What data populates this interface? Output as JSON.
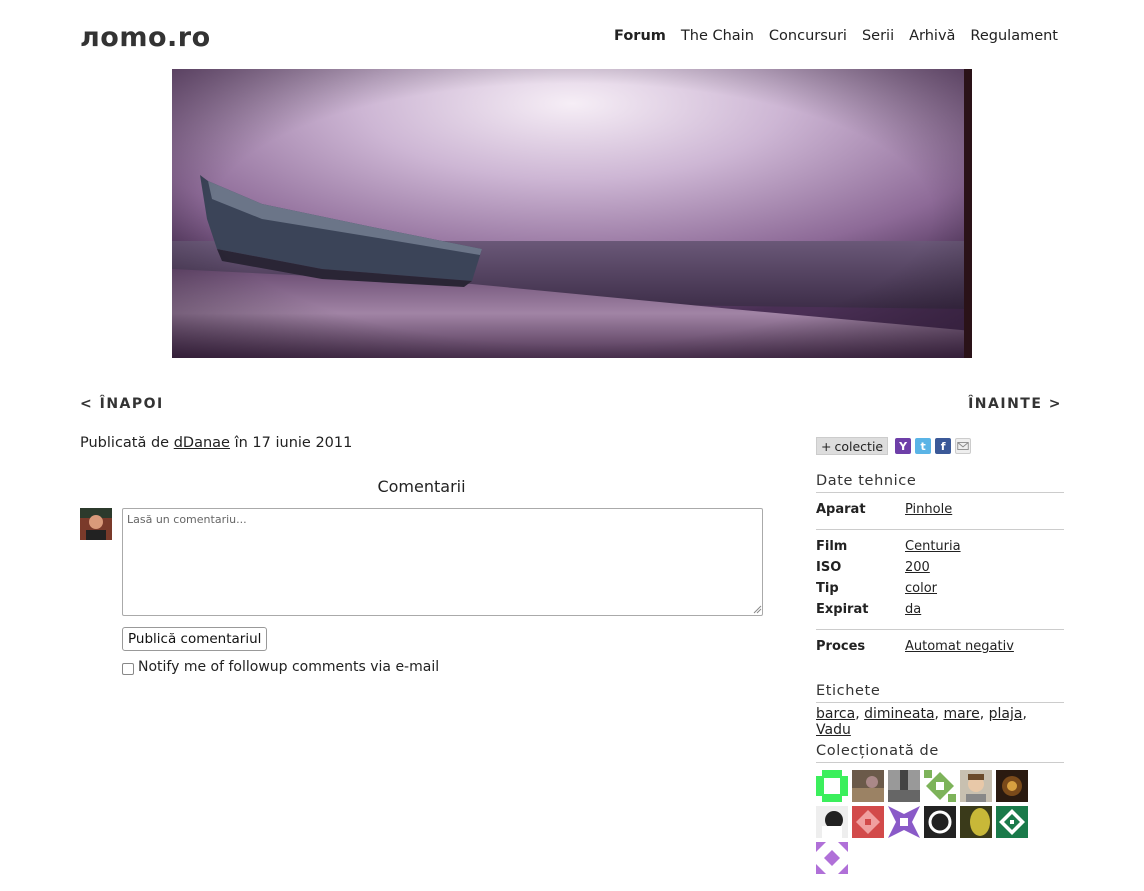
{
  "header": {
    "logo": "лomo.ro",
    "nav": [
      "Forum",
      "The Chain",
      "Concursuri",
      "Serii",
      "Arhivă",
      "Regulament"
    ]
  },
  "pager": {
    "prev": "< ÎNAPOI",
    "next": "ÎNAINTE >"
  },
  "byline": {
    "prefix": "Publicată de",
    "author": "dDanae",
    "suffix": "în 17 iunie 2011"
  },
  "comments": {
    "title": "Comentarii",
    "placeholder": "Lasă un comentariu...",
    "submit": "Publică comentariul",
    "notify": "Notify me of followup comments via e-mail"
  },
  "sidebar": {
    "collection_button": "colectie",
    "collection_plus": "+",
    "share_icons": [
      "yahoo-icon",
      "twitter-icon",
      "facebook-icon",
      "email-icon"
    ],
    "tech_title": "Date tehnice",
    "tech_groups": [
      [
        {
          "k": "Aparat",
          "v": "Pinhole"
        }
      ],
      [
        {
          "k": "Film",
          "v": "Centuria"
        },
        {
          "k": "ISO",
          "v": "200"
        },
        {
          "k": "Tip",
          "v": "color"
        },
        {
          "k": "Expirat",
          "v": "da"
        }
      ],
      [
        {
          "k": "Proces",
          "v": "Automat negativ"
        }
      ]
    ],
    "tags_title": "Etichete",
    "tags": [
      "barca",
      "dimineata",
      "mare",
      "plaja",
      "Vadu"
    ],
    "collected_title": "Colecționată de"
  }
}
